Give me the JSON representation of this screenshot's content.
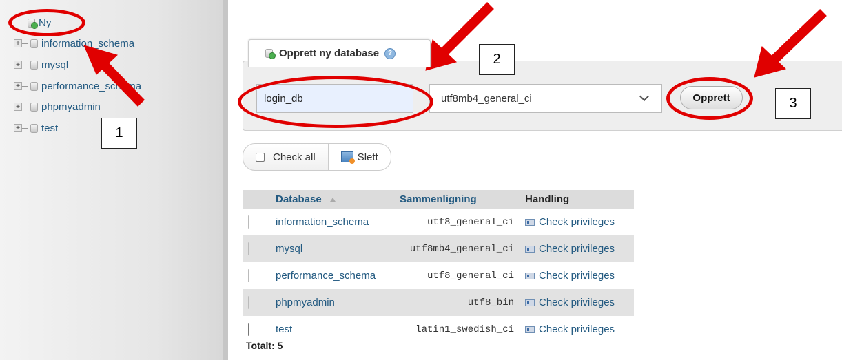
{
  "sidebar": {
    "new_label": "Ny",
    "databases": [
      "information_schema",
      "mysql",
      "performance_schema",
      "phpmyadmin",
      "test"
    ]
  },
  "create": {
    "tab_label": "Opprett ny database",
    "db_name_value": "login_db",
    "collation_value": "utf8mb4_general_ci",
    "button_label": "Opprett"
  },
  "actions": {
    "check_all_label": "Check all",
    "delete_label": "Slett"
  },
  "table": {
    "headers": [
      "Database",
      "Sammenligning",
      "Handling"
    ],
    "rows": [
      {
        "name": "information_schema",
        "collation": "utf8_general_ci",
        "action": "Check privileges"
      },
      {
        "name": "mysql",
        "collation": "utf8mb4_general_ci",
        "action": "Check privileges"
      },
      {
        "name": "performance_schema",
        "collation": "utf8_general_ci",
        "action": "Check privileges"
      },
      {
        "name": "phpmyadmin",
        "collation": "utf8_bin",
        "action": "Check privileges"
      },
      {
        "name": "test",
        "collation": "latin1_swedish_ci",
        "action": "Check privileges"
      }
    ],
    "total": "Totalt: 5"
  },
  "annotations": {
    "labels": [
      "1",
      "2",
      "3"
    ],
    "color": "#e00000"
  }
}
